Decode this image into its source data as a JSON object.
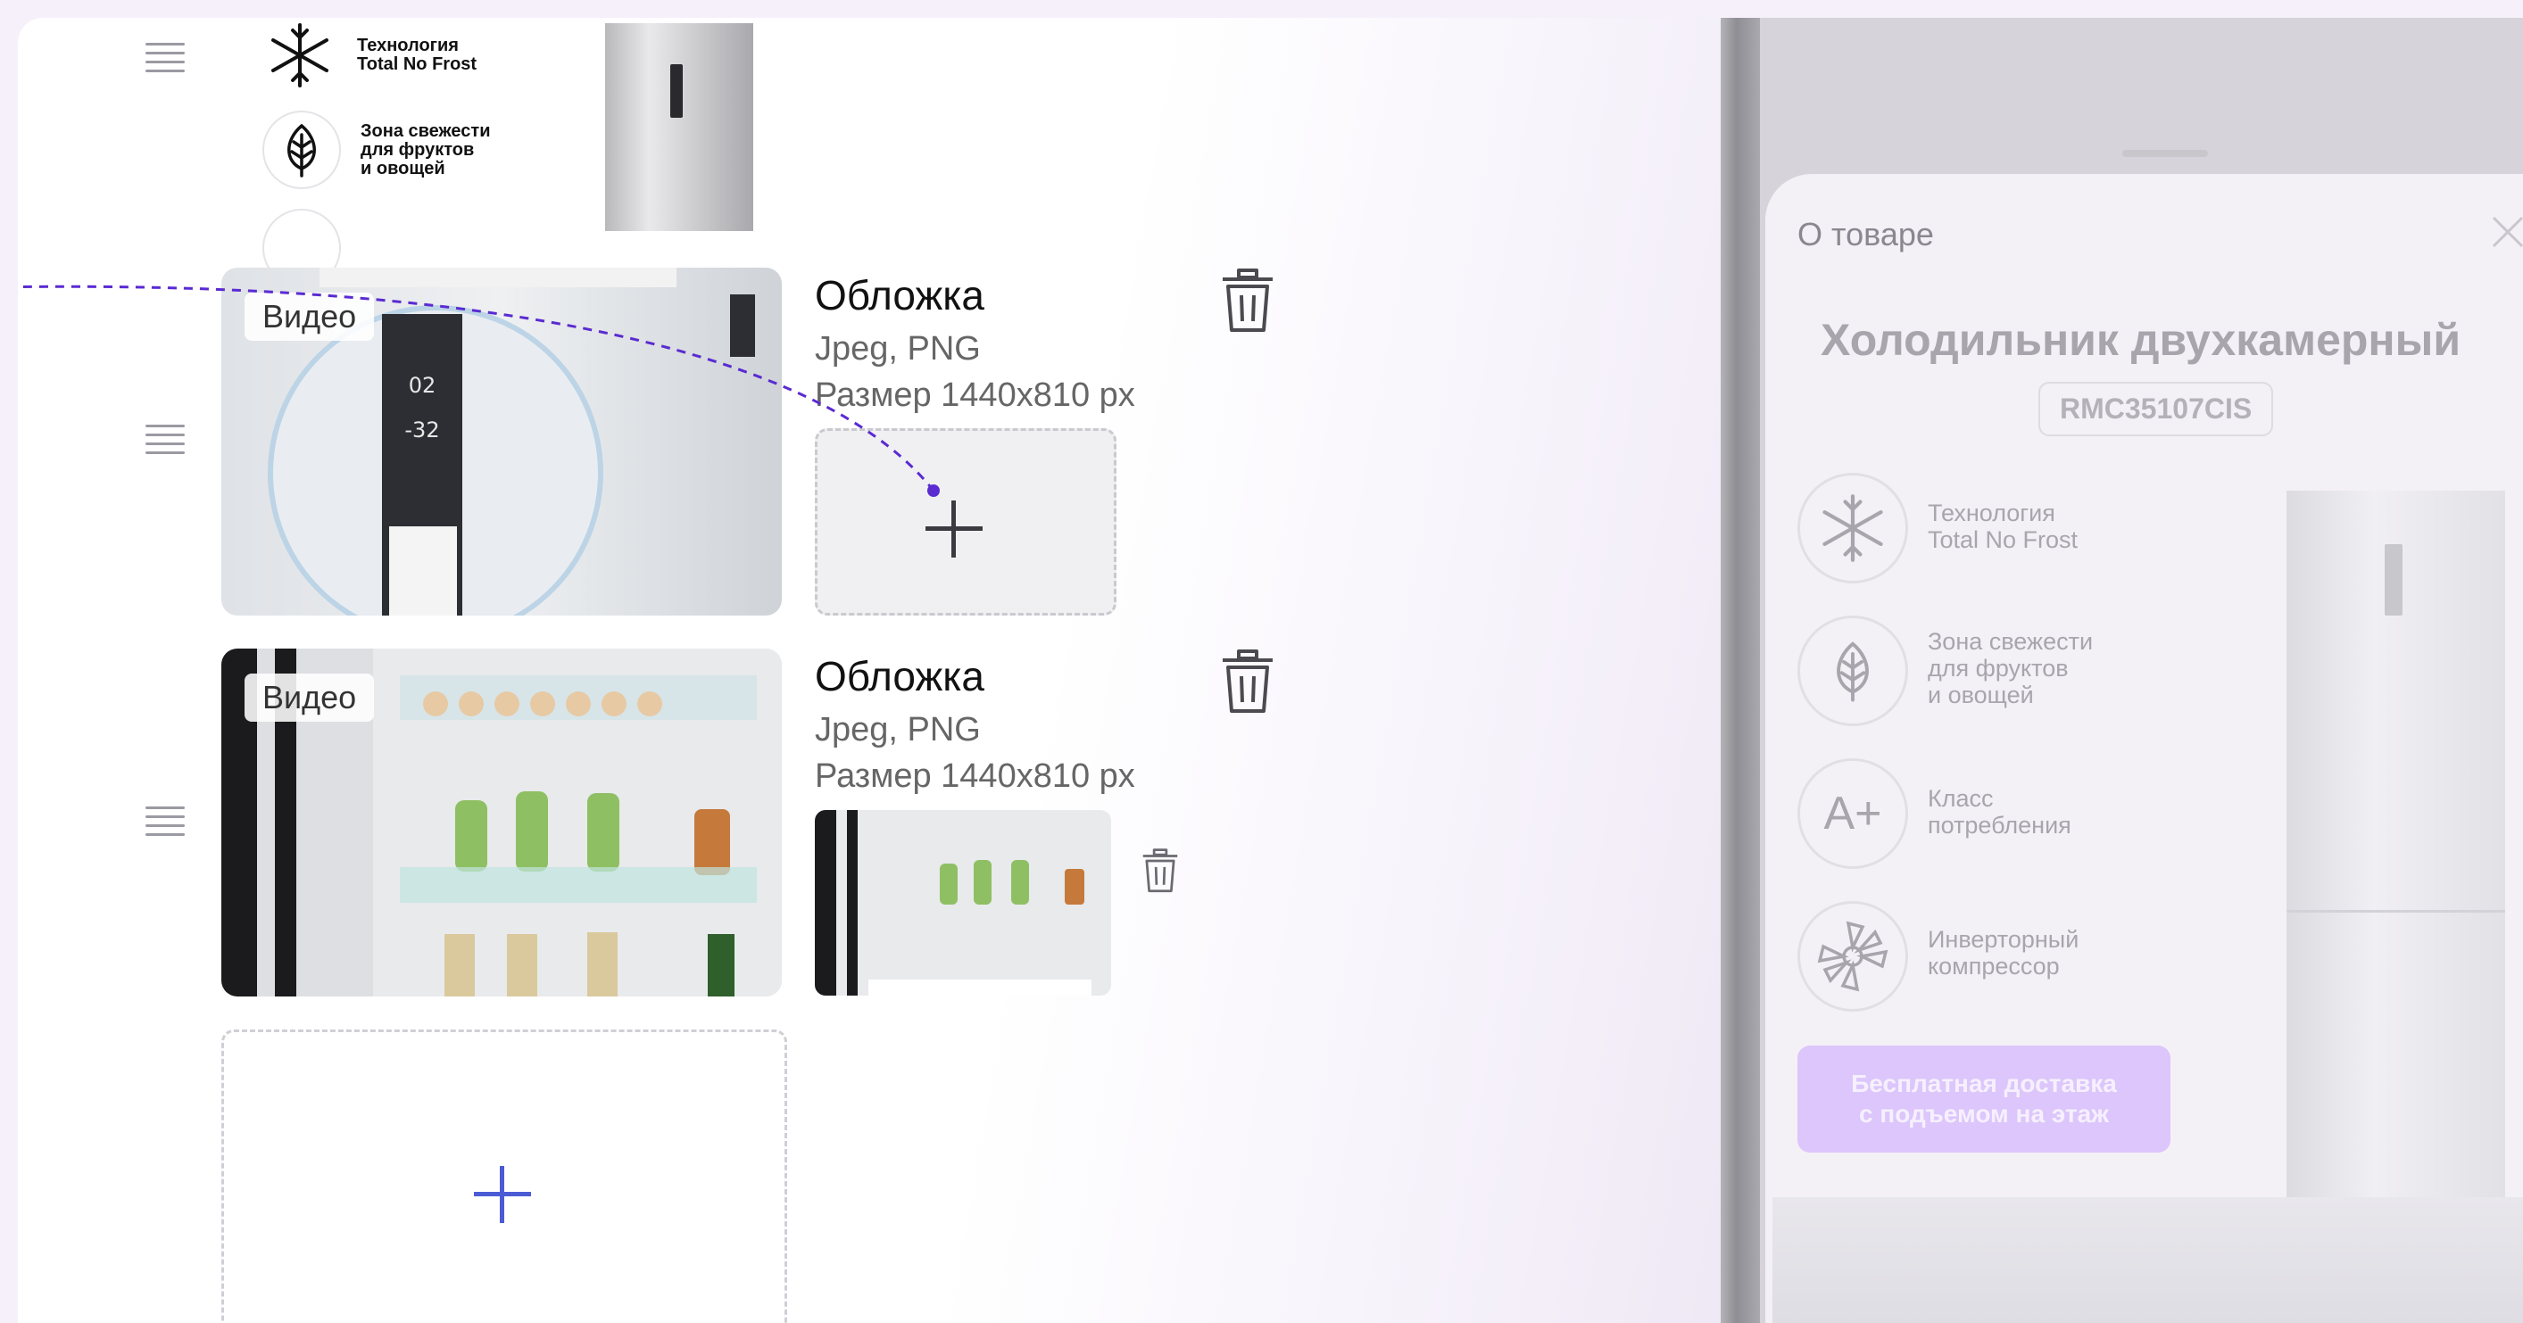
{
  "top_row": {
    "features": [
      {
        "icon": "snowflake-icon",
        "label": "Технология\nTotal No Frost"
      },
      {
        "icon": "leaf-icon",
        "label": "Зона свежести\nдля фруктов\nи овощей"
      }
    ]
  },
  "slides": [
    {
      "tag": "Видео",
      "title": "Обложка",
      "formats": "Jpeg, PNG",
      "size": "Размер 1440x810 px",
      "has_cover": false
    },
    {
      "tag": "Видео",
      "title": "Обложка",
      "formats": "Jpeg, PNG",
      "size": "Размер 1440x810 px",
      "has_cover": true
    }
  ],
  "phone": {
    "header": "О товаре",
    "product_title": "Холодильник двухкамерный",
    "sku": "RMC35107CIS",
    "features": [
      {
        "icon": "snowflake-icon",
        "label": "Технология\nTotal No Frost"
      },
      {
        "icon": "leaf-icon",
        "label": "Зона свежести\nдля фруктов\nи овощей"
      },
      {
        "icon": "energy-class-icon",
        "glyph": "A+",
        "label": "Класс\nпотребления"
      },
      {
        "icon": "compressor-icon",
        "label": "Инверторный\nкомпрессор"
      }
    ],
    "cta": "Бесплатная доставка\nс подъемом на этаж"
  },
  "colors": {
    "accent": "#4b5bd6",
    "drag_line": "#5a2bd1",
    "cta": "#dcc6fb"
  }
}
